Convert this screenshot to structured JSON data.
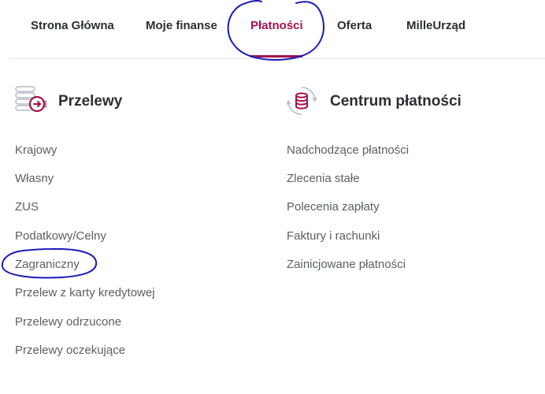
{
  "nav": {
    "items": [
      {
        "label": "Strona Główna"
      },
      {
        "label": "Moje finanse"
      },
      {
        "label": "Płatności"
      },
      {
        "label": "Oferta"
      },
      {
        "label": "MilleUrząd"
      }
    ],
    "active_color": "#a5124f"
  },
  "przelewy": {
    "icon": "transfer-icon",
    "title": "Przelewy",
    "links": [
      {
        "label": "Krajowy"
      },
      {
        "label": "Własny"
      },
      {
        "label": "ZUS"
      },
      {
        "label": "Podatkowy/Celny"
      },
      {
        "label": "Zagraniczny"
      },
      {
        "label": "Przelew z karty kredytowej"
      },
      {
        "label": "Przelewy odrzucone"
      },
      {
        "label": "Przelewy oczekujące"
      }
    ]
  },
  "centrum": {
    "icon": "payment-center-icon",
    "title": "Centrum płatności",
    "links": [
      {
        "label": "Nadchodzące płatności"
      },
      {
        "label": "Zlecenia stałe"
      },
      {
        "label": "Polecenia zapłaty"
      },
      {
        "label": "Faktury i rachunki"
      },
      {
        "label": "Zainicjowane płatności"
      }
    ]
  },
  "annotation_color": "#1a1ab8"
}
